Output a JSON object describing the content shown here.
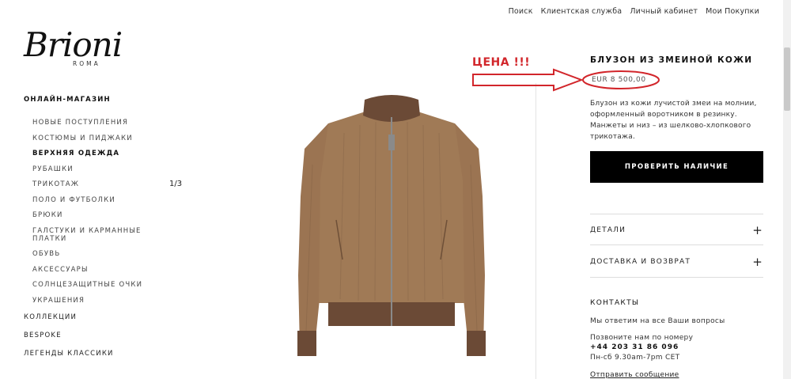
{
  "top_nav": [
    "Поиск",
    "Клиентская служба",
    "Личный кабинет",
    "Мои Покупки"
  ],
  "logo": {
    "script": "Brioni",
    "sub": "ROMA"
  },
  "sidebar": {
    "section_title": "ОНЛАЙН-МАГАЗИН",
    "items": [
      {
        "label": "НОВЫЕ ПОСТУПЛЕНИЯ",
        "active": false
      },
      {
        "label": "КОСТЮМЫ И ПИДЖАКИ",
        "active": false
      },
      {
        "label": "ВЕРХНЯЯ ОДЕЖДА",
        "active": true
      },
      {
        "label": "РУБАШКИ",
        "active": false
      },
      {
        "label": "ТРИКОТАЖ",
        "active": false
      },
      {
        "label": "ПОЛО И ФУТБОЛКИ",
        "active": false
      },
      {
        "label": "БРЮКИ",
        "active": false
      },
      {
        "label": "ГАЛСТУКИ И КАРМАННЫЕ ПЛАТКИ",
        "active": false
      },
      {
        "label": "ОБУВЬ",
        "active": false
      },
      {
        "label": "АКСЕССУАРЫ",
        "active": false
      },
      {
        "label": "СОЛНЦЕЗАЩИТНЫЕ ОЧКИ",
        "active": false
      },
      {
        "label": "УКРАШЕНИЯ",
        "active": false
      }
    ],
    "bottom_links": [
      "КОЛЛЕКЦИИ",
      "BESPOKE",
      "ЛЕГЕНДЫ КЛАССИКИ"
    ]
  },
  "gallery": {
    "counter": "1/3"
  },
  "annotation": {
    "text": "ЦЕНА !!!",
    "color": "#d2262b"
  },
  "product": {
    "title": "БЛУЗОН ИЗ ЗМЕИНОЙ КОЖИ",
    "price": "EUR 8 500,00",
    "description": "Блузон из кожи лучистой змеи на молнии, оформленный воротником в резинку. Манжеты и низ – из шелково-хлопкового трикотажа.",
    "check_button": "ПРОВЕРИТЬ НАЛИЧИЕ",
    "accordion": [
      "ДЕТАЛИ",
      "ДОСТАВКА И ВОЗВРАТ"
    ]
  },
  "contacts": {
    "title": "КОНТАКТЫ",
    "line1": "Мы ответим на все Ваши вопросы",
    "line2": "Позвоните нам по номеру",
    "phone": "+44 203 31 86 096",
    "hours": "Пн-сб 9.30am-7pm CET",
    "message_link": "Отправить сообщение"
  },
  "colors": {
    "button_bg": "#000000",
    "jacket": "#9b7452",
    "rib": "#6b4a36"
  }
}
